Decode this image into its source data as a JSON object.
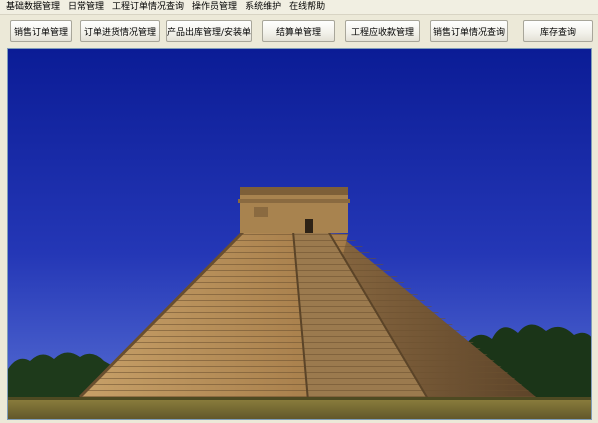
{
  "menubar": {
    "items": [
      {
        "label": "基础数据管理"
      },
      {
        "label": "日常管理"
      },
      {
        "label": "工程订单情况查询"
      },
      {
        "label": "操作员管理"
      },
      {
        "label": "系统维护"
      },
      {
        "label": "在线帮助"
      }
    ]
  },
  "toolbar": {
    "buttons": [
      {
        "label": "销售订单管理"
      },
      {
        "label": "订单进货情况管理"
      },
      {
        "label": "产品出库管理/安装单"
      },
      {
        "label": "结算单管理"
      },
      {
        "label": "工程应收款管理"
      },
      {
        "label": "销售订单情况查询"
      },
      {
        "label": "库存查询"
      }
    ]
  },
  "colors": {
    "sky_top": "#0d1f9a",
    "sky_bottom": "#4f6fd8",
    "stone": "#b48a55",
    "stone_dark": "#6e5232",
    "grass": "#7c7436",
    "trees": "#1f3a1c"
  },
  "content": {
    "image_icon": "pyramid-photo"
  }
}
